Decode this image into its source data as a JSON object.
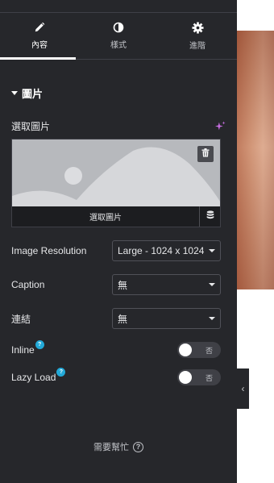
{
  "tabs": [
    {
      "label": "內容",
      "icon": "pencil-icon",
      "active": true
    },
    {
      "label": "樣式",
      "icon": "contrast-icon",
      "active": false
    },
    {
      "label": "進階",
      "icon": "gear-icon",
      "active": false
    }
  ],
  "section": {
    "title": "圖片",
    "expanded": true
  },
  "image": {
    "label": "選取圖片",
    "choose_label": "選取圖片",
    "ai_icon": "ai-sparkle-icon",
    "delete_icon": "trash-icon",
    "library_icon": "stack-icon"
  },
  "fields": {
    "resolution": {
      "label": "Image Resolution",
      "value": "Large - 1024 x 1024"
    },
    "caption": {
      "label": "Caption",
      "value": "無"
    },
    "link": {
      "label": "連結",
      "value": "無"
    },
    "inline": {
      "label": "Inline",
      "help": "?",
      "state": "否"
    },
    "lazy_load": {
      "label": "Lazy Load",
      "help": "?",
      "state": "否"
    }
  },
  "help": {
    "label": "需要幫忙",
    "icon": "question-circle-icon"
  },
  "colors": {
    "panel_bg": "#26272b",
    "accent_help": "#22a9d8",
    "ai_accent": "#c86ee3"
  }
}
